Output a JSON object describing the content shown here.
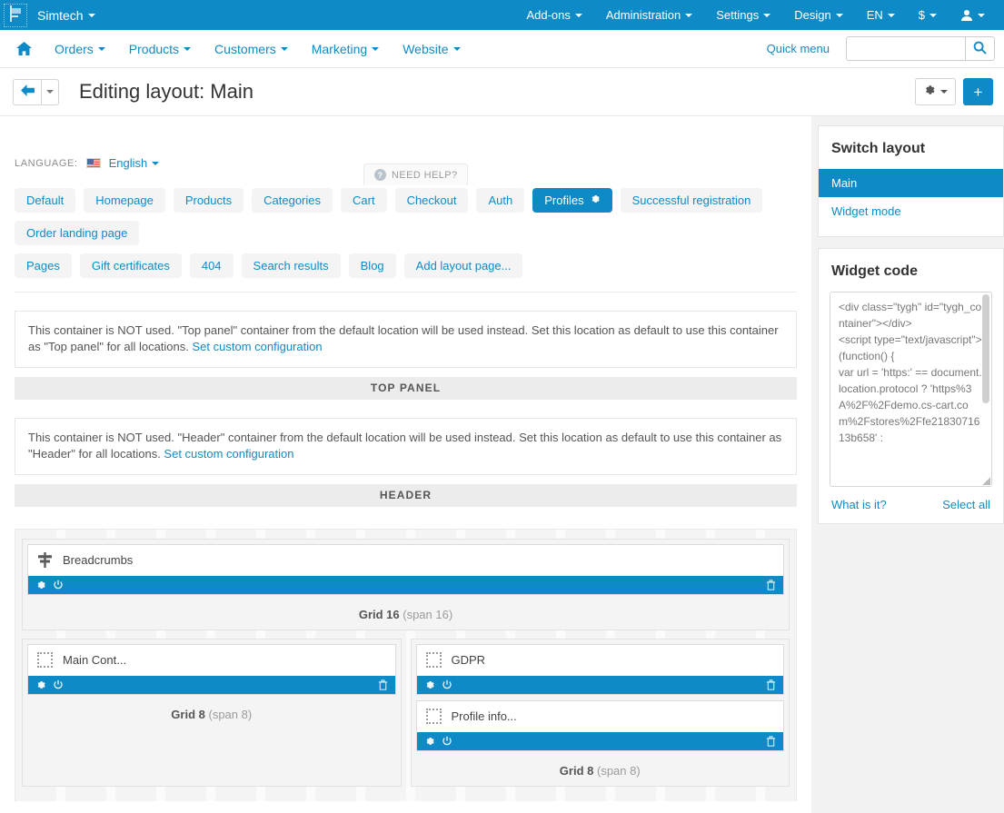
{
  "topbar": {
    "brand": "Simtech",
    "logo_icon": "flag-icon",
    "nav": [
      {
        "label": "Add-ons",
        "caret": true
      },
      {
        "label": "Administration",
        "caret": true
      },
      {
        "label": "Settings",
        "caret": true
      },
      {
        "label": "Design",
        "caret": true
      },
      {
        "label": "EN",
        "caret": true
      },
      {
        "label": "$",
        "caret": true
      }
    ],
    "user_icon": "user-icon"
  },
  "subnav": {
    "home_icon": "home-icon",
    "items": [
      {
        "label": "Orders"
      },
      {
        "label": "Products"
      },
      {
        "label": "Customers"
      },
      {
        "label": "Marketing"
      },
      {
        "label": "Website"
      }
    ],
    "quick_menu": "Quick menu",
    "search_value": "",
    "search_placeholder": "",
    "search_icon": "search-icon"
  },
  "titlebar": {
    "back_icon": "arrow-left-icon",
    "back_caret_icon": "chevron-down-icon",
    "title": "Editing layout: Main",
    "gear_icon": "gear-icon",
    "gear_caret_icon": "chevron-down-icon",
    "plus_label": "+",
    "need_help": "NEED HELP?",
    "need_help_icon": "question-circle-icon"
  },
  "language": {
    "label": "LANGUAGE:",
    "flag_icon": "us-flag-icon",
    "value": "English"
  },
  "tabs": {
    "row1": [
      {
        "label": "Default",
        "active": false
      },
      {
        "label": "Homepage",
        "active": false
      },
      {
        "label": "Products",
        "active": false
      },
      {
        "label": "Categories",
        "active": false
      },
      {
        "label": "Cart",
        "active": false
      },
      {
        "label": "Checkout",
        "active": false
      },
      {
        "label": "Auth",
        "active": false
      },
      {
        "label": "Profiles",
        "active": true,
        "icon": "gear-icon"
      },
      {
        "label": "Successful registration",
        "active": false
      },
      {
        "label": "Order landing page",
        "active": false
      }
    ],
    "row2": [
      {
        "label": "Pages",
        "active": false
      },
      {
        "label": "Gift certificates",
        "active": false
      },
      {
        "label": "404",
        "active": false
      },
      {
        "label": "Search results",
        "active": false
      },
      {
        "label": "Blog",
        "active": false
      },
      {
        "label": "Add layout page...",
        "active": false
      }
    ]
  },
  "containers": [
    {
      "notice": "This container is NOT used. \"Top panel\" container from the default location will be used instead. Set this location as default to use this container as \"Top panel\" for all locations. ",
      "notice_link": "Set custom configuration",
      "bar_label": "TOP PANEL"
    },
    {
      "notice": "This container is NOT used. \"Header\" container from the default location will be used instead. Set this location as default to use this container as \"Header\" for all locations. ",
      "notice_link": "Set custom configuration",
      "bar_label": "HEADER"
    }
  ],
  "grid": {
    "rows": [
      {
        "cells": [
          {
            "label_name": "Grid 16",
            "label_span": "(span 16)",
            "blocks": [
              {
                "title": "Breadcrumbs",
                "icon": "signpost-icon",
                "toolbar": {
                  "gear": "gear-icon",
                  "power": "power-icon",
                  "trash": "trash-icon"
                }
              }
            ]
          }
        ]
      },
      {
        "cells": [
          {
            "label_name": "Grid 8",
            "label_span": "(span 8)",
            "blocks": [
              {
                "title": "Main Cont...",
                "icon": "dashed-box-icon",
                "toolbar": {
                  "gear": "gear-icon",
                  "power": "power-icon",
                  "trash": "trash-icon"
                }
              }
            ]
          },
          {
            "label_name": "Grid 8",
            "label_span": "(span 8)",
            "blocks": [
              {
                "title": "GDPR",
                "icon": "dashed-box-icon",
                "toolbar": {
                  "gear": "gear-icon",
                  "power": "power-icon",
                  "trash": "trash-icon"
                }
              },
              {
                "title": "Profile info...",
                "icon": "dashed-box-icon",
                "toolbar": {
                  "gear": "gear-icon",
                  "power": "power-icon",
                  "trash": "trash-icon"
                }
              }
            ]
          }
        ]
      }
    ]
  },
  "sidebar": {
    "switch_layout": {
      "title": "Switch layout",
      "items": [
        {
          "label": "Main",
          "active": true
        },
        {
          "label": "Widget mode",
          "active": false
        }
      ]
    },
    "widget_code": {
      "title": "Widget code",
      "code": "<div class=\"tygh\" id=\"tygh_container\"></div>\n<script type=\"text/javascript\">\n(function() {\nvar url = 'https:' == document.location.protocol ? 'https%3A%2F%2Fdemo.cs-cart.com%2Fstores%2Ffe2183071613b658' :",
      "what_is_it": "What is it?",
      "select_all": "Select all"
    }
  },
  "colors": {
    "accent": "#0e8bc7",
    "link": "#0e8bc7",
    "tab_bg": "#f4f4f4",
    "page_bg": "#f2f2f2"
  }
}
